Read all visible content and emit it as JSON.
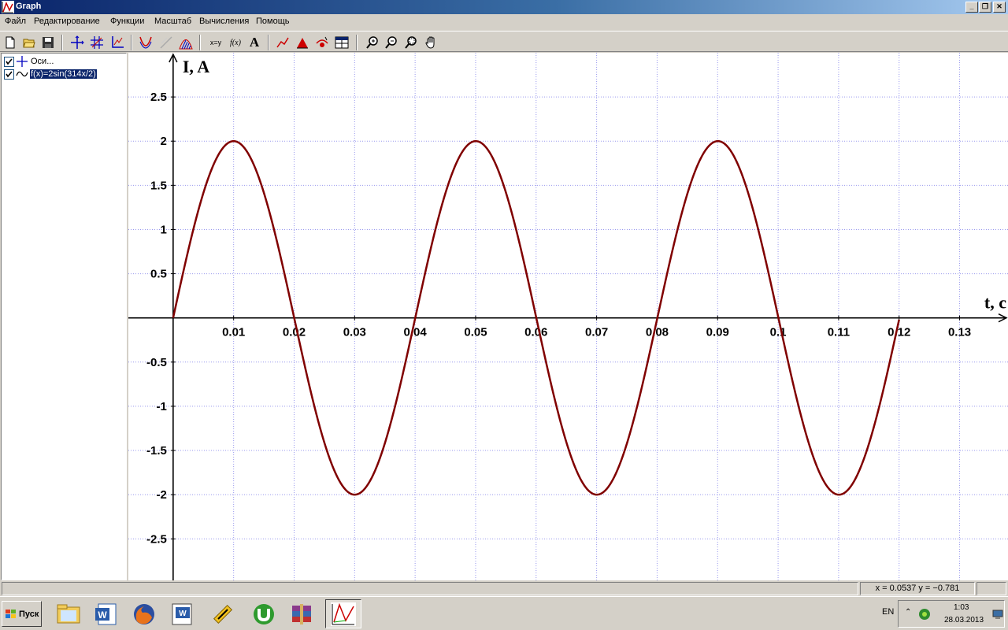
{
  "window": {
    "title": "Graph"
  },
  "menu": [
    "Файл",
    "Редактирование",
    "Функции",
    "Масштаб",
    "Вычисления",
    "Помощь"
  ],
  "window_buttons": {
    "minimize": "_",
    "restore": "❐",
    "close": "✕"
  },
  "toolbar": {
    "buttons": [
      "new-icon",
      "open-icon",
      "save-icon",
      "axes-icon",
      "grid-icon",
      "axes-edit-icon",
      "function-icon",
      "tangent-icon",
      "shading-icon",
      "series-icon",
      "relation-icon",
      "text-icon",
      "line-icon",
      "area-icon",
      "point-series-icon",
      "table-icon",
      "zoom-in-icon",
      "zoom-out-icon",
      "zoom-window-icon",
      "hand-icon"
    ],
    "xy_label": "x=y",
    "fx_label": "f(x)",
    "text_label": "A"
  },
  "tree": {
    "axes_label": "Оси...",
    "function_label": "f(x)=2sin(314x/2)"
  },
  "status": {
    "coords": "x = 0.0537    y = −0.781"
  },
  "taskbar": {
    "start_label": "Пуск",
    "lang": "EN",
    "time": "1:03",
    "date": "28.03.2013"
  },
  "colors": {
    "curve": "#800000",
    "grid": "#9999ee",
    "titlebar": "#0a246a"
  },
  "chart_data": {
    "type": "line",
    "xlabel": "t, c",
    "ylabel": "I, A",
    "xlim": [
      -0.0074,
      0.138
    ],
    "ylim": [
      -2.97,
      3.0
    ],
    "xticks": [
      0.01,
      0.02,
      0.03,
      0.04,
      0.05,
      0.06,
      0.07,
      0.08,
      0.09,
      0.1,
      0.11,
      0.12,
      0.13
    ],
    "xtick_labels": [
      "0.01",
      "0.02",
      "0.03",
      "0.04",
      "0.05",
      "0.06",
      "0.07",
      "0.08",
      "0.09",
      "0.1",
      "0.11",
      "0.12",
      "0.13"
    ],
    "yticks": [
      2.5,
      2,
      1.5,
      1,
      0.5,
      -0.5,
      -1,
      -1.5,
      -2,
      -2.5
    ],
    "ytick_labels": [
      "2.5",
      "2",
      "1.5",
      "1",
      "0.5",
      "-0.5",
      "-1",
      "-1.5",
      "-2",
      "-2.5"
    ],
    "grid": true,
    "series": [
      {
        "name": "f(x)=2sin(314x/2)",
        "function": "2sin(157x)",
        "amplitude": 2,
        "x_start": 0,
        "x_end": 0.12
      }
    ]
  }
}
